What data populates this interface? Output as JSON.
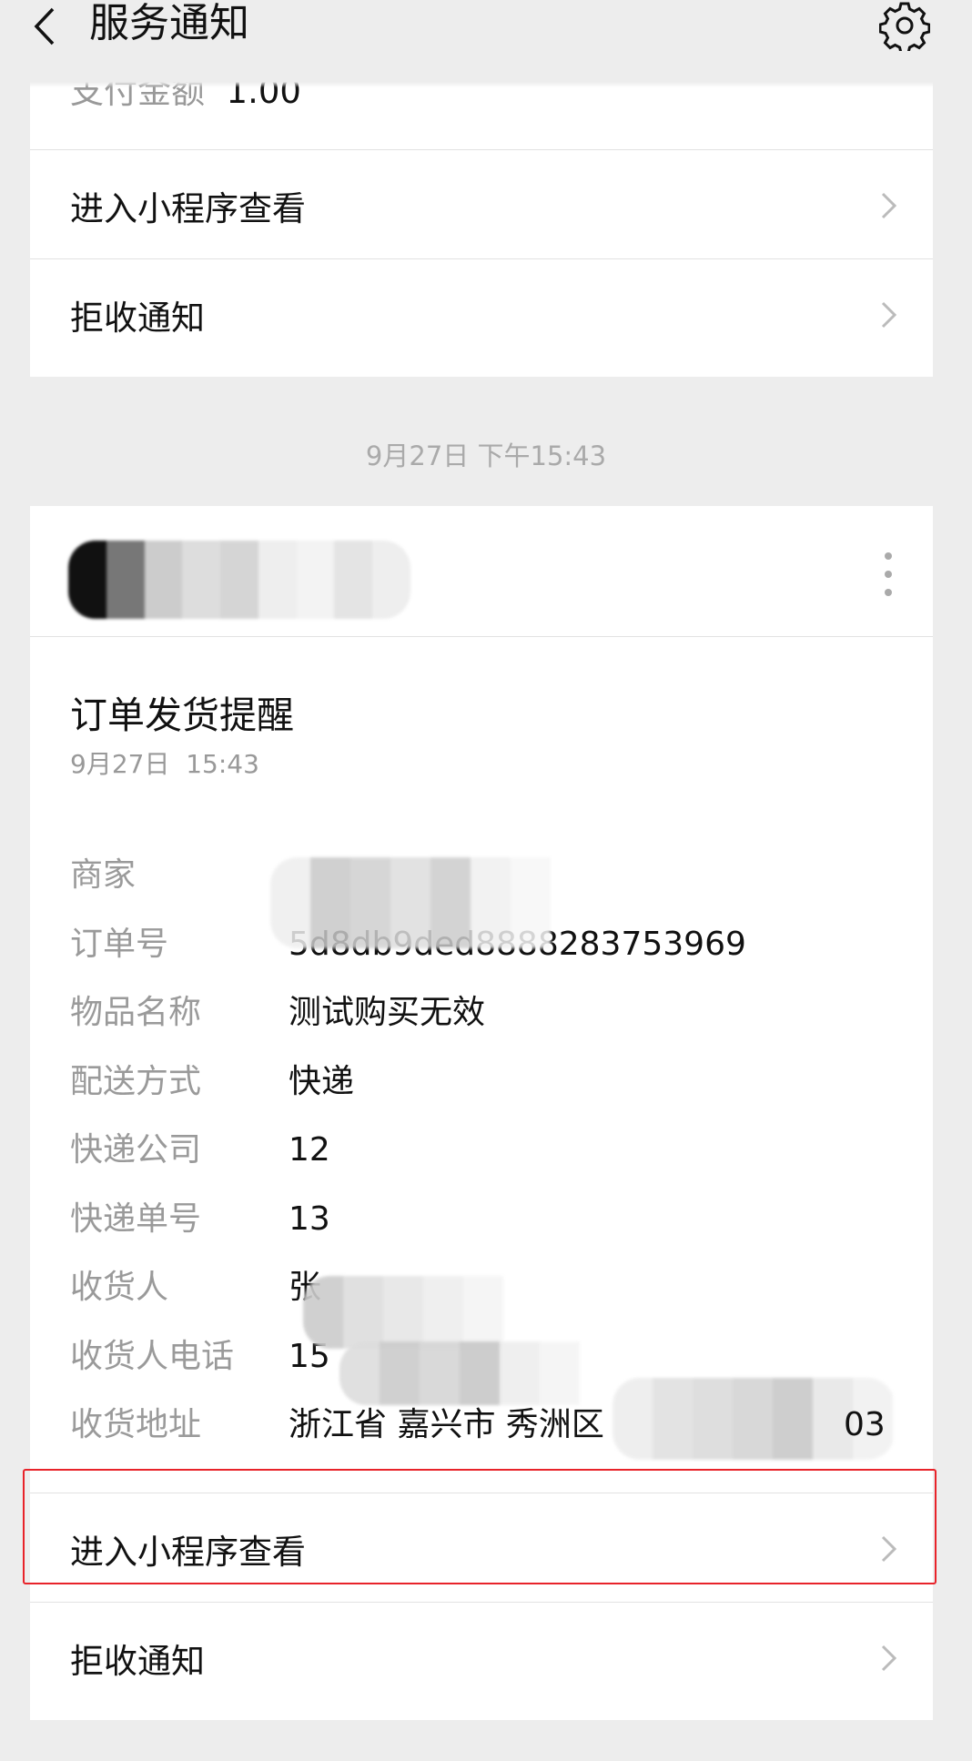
{
  "header": {
    "title": "服务通知",
    "back_icon": "chevron-left-icon",
    "settings_icon": "gear-icon"
  },
  "card1": {
    "partial_label": "支付金额",
    "partial_value": "1.00",
    "open_label": "进入小程序查看",
    "reject_label": "拒收通知"
  },
  "timestamp": "9月27日 下午15:43",
  "card2": {
    "title": "订单发货提醒",
    "date": "9月27日  15:43",
    "fields": [
      {
        "label": "商家",
        "value": ""
      },
      {
        "label": "订单号",
        "value": "5d8db9ded8888283753969"
      },
      {
        "label": "物品名称",
        "value": "测试购买无效"
      },
      {
        "label": "配送方式",
        "value": "快递"
      },
      {
        "label": "快递公司",
        "value": "12"
      },
      {
        "label": "快递单号",
        "value": "13"
      },
      {
        "label": "收货人",
        "value": "张"
      },
      {
        "label": "收货人电话",
        "value": "15"
      },
      {
        "label": "收货地址",
        "value": "浙江省 嘉兴市 秀洲区"
      }
    ],
    "address_tail": "03",
    "open_label": "进入小程序查看",
    "reject_label": "拒收通知"
  },
  "colors": {
    "highlight": "#e8232a",
    "background": "#ededed"
  }
}
